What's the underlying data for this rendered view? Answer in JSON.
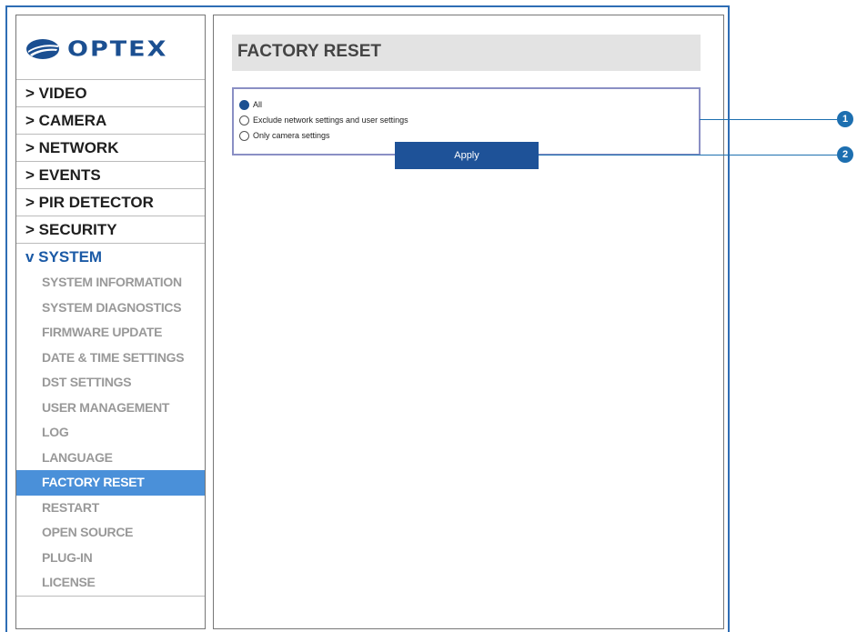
{
  "brand": {
    "name": "OPTEX"
  },
  "menu": [
    {
      "label": "> VIDEO"
    },
    {
      "label": "> CAMERA"
    },
    {
      "label": "> NETWORK"
    },
    {
      "label": "> EVENTS"
    },
    {
      "label": "> PIR DETECTOR"
    },
    {
      "label": "> SECURITY"
    },
    {
      "label": "v SYSTEM"
    }
  ],
  "submenu": [
    {
      "label": "SYSTEM INFORMATION"
    },
    {
      "label": "SYSTEM DIAGNOSTICS"
    },
    {
      "label": "FIRMWARE UPDATE"
    },
    {
      "label": "DATE & TIME SETTINGS"
    },
    {
      "label": "DST SETTINGS"
    },
    {
      "label": "USER MANAGEMENT"
    },
    {
      "label": "LOG"
    },
    {
      "label": "LANGUAGE"
    },
    {
      "label": "FACTORY RESET"
    },
    {
      "label": "RESTART"
    },
    {
      "label": "OPEN SOURCE"
    },
    {
      "label": "PLUG-IN"
    },
    {
      "label": "LICENSE"
    }
  ],
  "page": {
    "title": "FACTORY RESET",
    "options": [
      {
        "label": "All",
        "checked": true
      },
      {
        "label": "Exclude network settings and user settings",
        "checked": false
      },
      {
        "label": "Only camera settings",
        "checked": false
      }
    ],
    "apply_label": "Apply"
  },
  "callouts": [
    "1",
    "2"
  ],
  "colors": {
    "brand": "#1b4f91",
    "accent": "#4a90d9",
    "frame": "#2e6db4",
    "callout": "#1d6fb0"
  }
}
